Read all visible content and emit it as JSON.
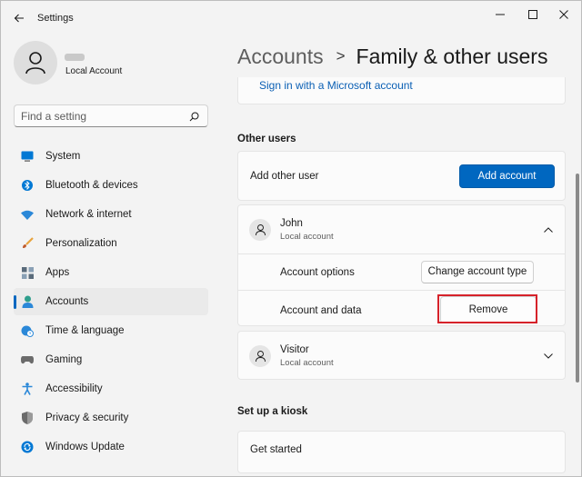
{
  "window": {
    "title": "Settings",
    "minimize_icon": "minimize-icon",
    "maximize_icon": "maximize-icon",
    "close_icon": "close-icon"
  },
  "profile": {
    "account_type": "Local Account"
  },
  "search": {
    "placeholder": "Find a setting"
  },
  "sidebar": {
    "items": [
      {
        "label": "System",
        "icon": "monitor-icon",
        "color": "#0078d4"
      },
      {
        "label": "Bluetooth & devices",
        "icon": "bluetooth-icon",
        "color": "#0078d4"
      },
      {
        "label": "Network & internet",
        "icon": "wifi-icon",
        "color": "#2b88d8"
      },
      {
        "label": "Personalization",
        "icon": "paintbrush-icon",
        "color": "#e8a33d"
      },
      {
        "label": "Apps",
        "icon": "apps-icon",
        "color": "#5a6b7b"
      },
      {
        "label": "Accounts",
        "icon": "person-icon",
        "color": "#2e9e8c"
      },
      {
        "label": "Time & language",
        "icon": "globe-clock-icon",
        "color": "#2b88d8"
      },
      {
        "label": "Gaming",
        "icon": "gamepad-icon",
        "color": "#6b6b6b"
      },
      {
        "label": "Accessibility",
        "icon": "accessibility-icon",
        "color": "#2b88d8"
      },
      {
        "label": "Privacy & security",
        "icon": "shield-icon",
        "color": "#6b6b6b"
      },
      {
        "label": "Windows Update",
        "icon": "update-icon",
        "color": "#0078d4"
      }
    ],
    "active_index": 5,
    "accent": "#0067c0"
  },
  "main": {
    "breadcrumb": {
      "parent": "Accounts",
      "separator": ">",
      "current": "Family & other users"
    },
    "signin_link": "Sign in with a Microsoft account",
    "other_users": {
      "heading": "Other users",
      "add_label": "Add other user",
      "add_button": "Add account",
      "users": [
        {
          "name": "John",
          "type": "Local account",
          "expanded": true,
          "options_label": "Account options",
          "options_button": "Change account type",
          "data_label": "Account and data",
          "data_button": "Remove"
        },
        {
          "name": "Visitor",
          "type": "Local account",
          "expanded": false
        }
      ]
    },
    "kiosk": {
      "heading": "Set up a kiosk",
      "label": "Get started"
    }
  },
  "colors": {
    "primary_button": "#0067c0",
    "highlight_box": "#d6222a",
    "link": "#0a5fb4"
  }
}
